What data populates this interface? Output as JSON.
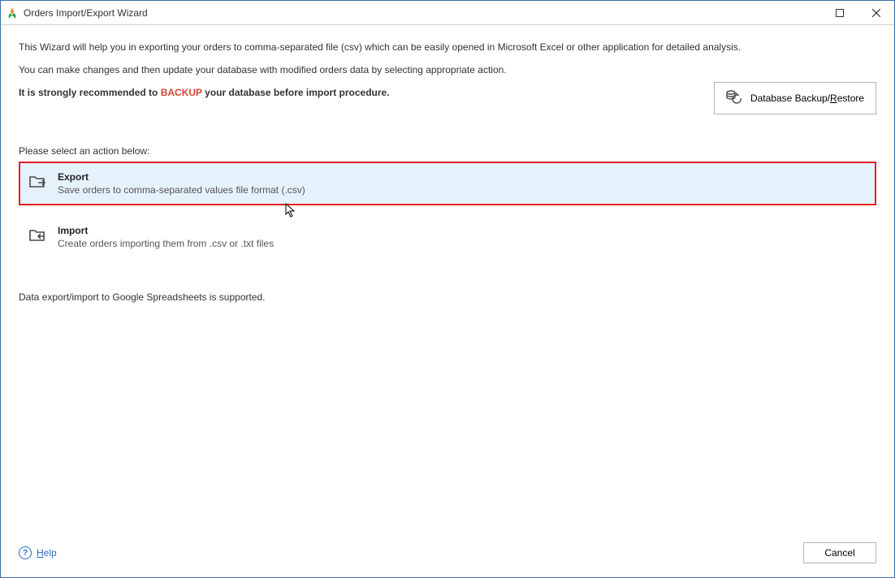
{
  "titlebar": {
    "title": "Orders Import/Export Wizard"
  },
  "intro": {
    "line1": "This Wizard will help you in exporting your orders to comma-separated file (csv) which can be easily opened in Microsoft Excel or other application for detailed analysis.",
    "line2": "You can make changes and then update your database with modified orders data by selecting appropriate action.",
    "line3_pre": "It is strongly recommended to ",
    "line3_backup": "BACKUP",
    "line3_post": " your database before import procedure."
  },
  "backup_button": {
    "pre": "Database Backup/",
    "u": "R",
    "post": "estore"
  },
  "section_label": "Please select an action below:",
  "options": {
    "export": {
      "title": "Export",
      "desc": "Save orders to comma-separated values file format (.csv)"
    },
    "import": {
      "title": "Import",
      "desc": "Create orders importing them from .csv or .txt files"
    }
  },
  "footnote": "Data export/import to Google Spreadsheets is supported.",
  "footer": {
    "help_u": "H",
    "help_post": "elp",
    "cancel": "Cancel",
    "help_q": "?"
  }
}
